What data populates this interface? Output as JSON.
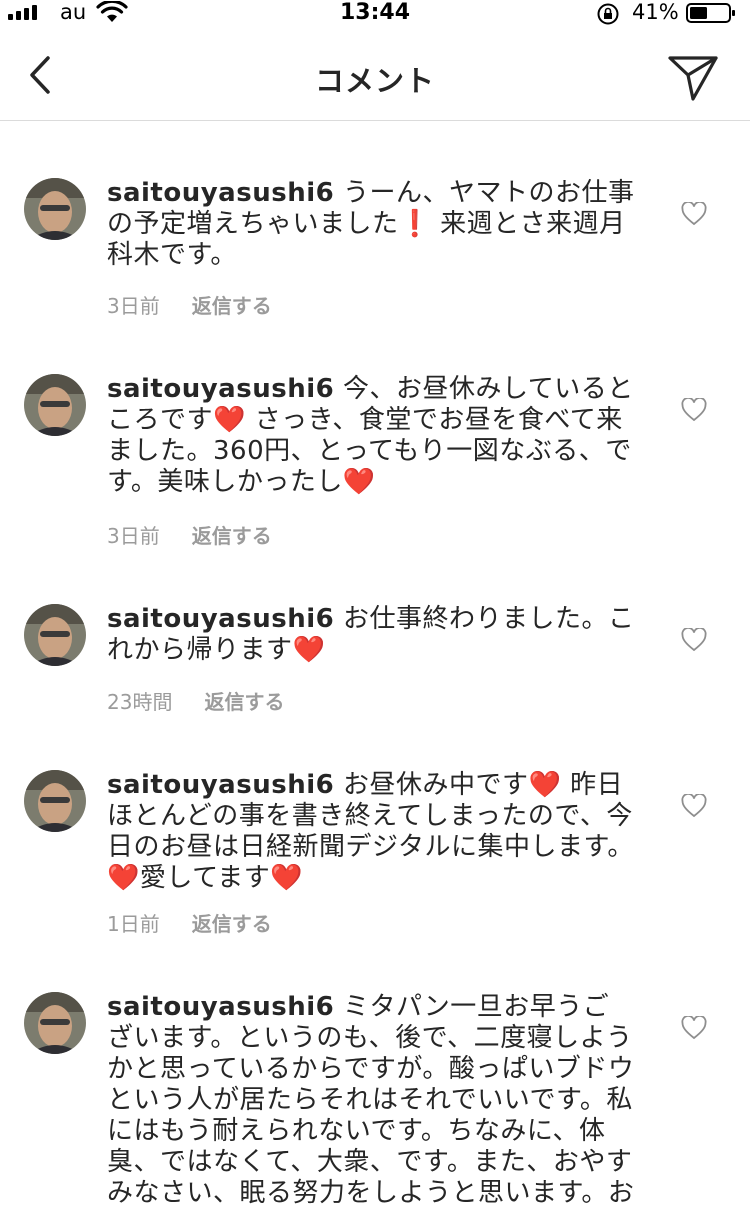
{
  "status": {
    "carrier": "au",
    "time": "13:44",
    "battery": "41%"
  },
  "nav": {
    "title": "コメント"
  },
  "icons": {
    "back": "chevron-left-icon",
    "send": "paper-plane-icon",
    "like": "heart-outline-icon",
    "accent_heart": "#e0202a"
  },
  "comments": [
    {
      "username": "saitouyasushi6",
      "parts": [
        " うーん、ヤマトのお仕事の予定増えちゃいました",
        "❗",
        " 来週とさ来週月科木です。"
      ],
      "time": "3日前",
      "reply": "返信する"
    },
    {
      "username": "saitouyasushi6",
      "parts": [
        " 今、お昼休みしているところです",
        "❤️",
        " さっき、食堂でお昼を食べて来ました。360円、とってもり一図なぶる、です。美味しかったし",
        "❤️"
      ],
      "time": "3日前",
      "reply": "返信する"
    },
    {
      "username": "saitouyasushi6",
      "parts": [
        " お仕事終わりました。これから帰ります",
        "❤️"
      ],
      "time": "23時間",
      "reply": "返信する"
    },
    {
      "username": "saitouyasushi6",
      "parts": [
        " お昼休み中です",
        "❤️",
        " 昨日ほとんどの事を書き終えてしまったので、今日のお昼は日経新聞デジタルに集中します。",
        "❤️",
        "愛してます",
        "❤️"
      ],
      "time": "1日前",
      "reply": "返信する"
    },
    {
      "username": "saitouyasushi6",
      "parts": [
        " ミタパン一旦お早うございます。というのも、後で、二度寝しようかと思っているからですが。酸っぱいブドウという人が居たらそれはそれでいいです。私にはもう耐えられないです。ちなみに、体臭、ではなくて、大衆、です。また、おやすみなさい、眠る努力をしようと思います。お休みなさい。"
      ],
      "time": "",
      "reply": ""
    }
  ]
}
